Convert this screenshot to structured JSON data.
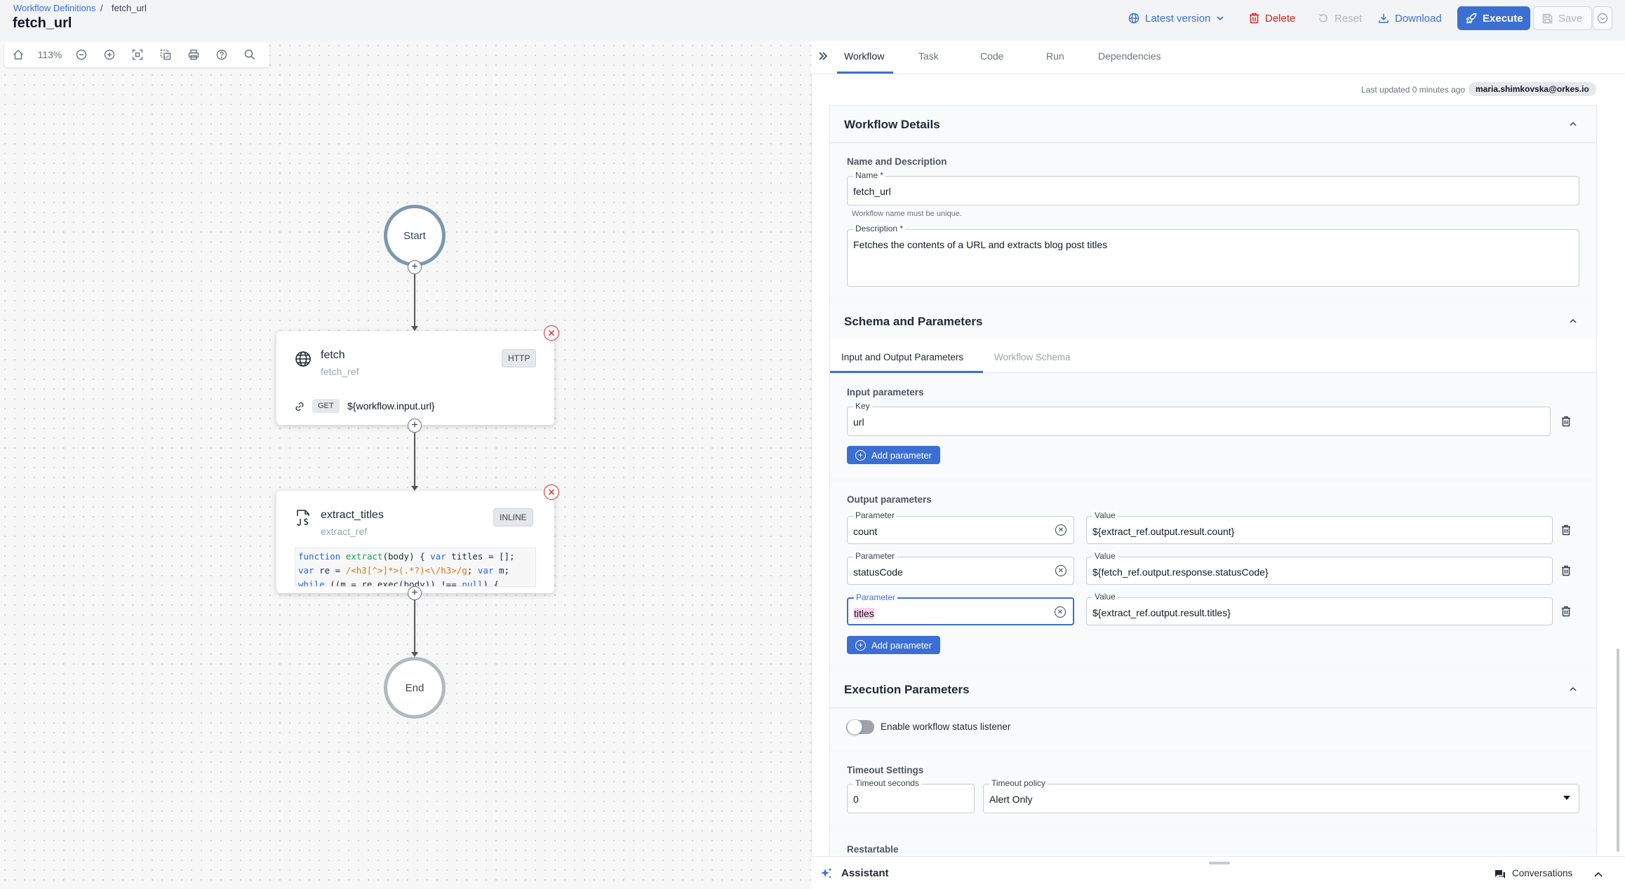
{
  "breadcrumb": {
    "parent": "Workflow Definitions",
    "separator": "/",
    "current": "fetch_url"
  },
  "page_title": "fetch_url",
  "header_actions": {
    "version": "Latest version",
    "delete": "Delete",
    "reset": "Reset",
    "download": "Download",
    "execute": "Execute",
    "save": "Save"
  },
  "canvas_toolbar": {
    "zoom": "113%"
  },
  "diagram": {
    "start": "Start",
    "end": "End",
    "fetch": {
      "name": "fetch",
      "ref": "fetch_ref",
      "type": "HTTP",
      "method": "GET",
      "uri": "${workflow.input.url}"
    },
    "extract": {
      "name": "extract_titles",
      "ref": "extract_ref",
      "type": "INLINE",
      "code_line1": {
        "kw1": "function",
        "fn": " extract",
        "rest1": "(body) { ",
        "kw2": "var",
        "rest2": " titles = [];"
      },
      "code_line2": {
        "kw1": "var",
        "rest1": " re = ",
        "regex": "/<h3[^>]*>(.*?)<\\/h3>/g",
        "rest2": "; ",
        "kw2": "var",
        "rest3": " m;"
      },
      "code_line3": {
        "kw1": "while",
        "rest1": " ((m = re.exec(body)) !== ",
        "kw2": "null",
        "rest2": ") {"
      }
    }
  },
  "panel_tabs": [
    "Workflow",
    "Task",
    "Code",
    "Run",
    "Dependencies"
  ],
  "meta": {
    "last_updated": "Last updated 0 minutes ago",
    "user": "maria.shimkovska@orkes.io"
  },
  "workflow_details": {
    "title": "Workflow Details",
    "subtitle": "Name and Description",
    "name_label": "Name *",
    "name_value": "fetch_url",
    "name_helper": "Workflow name must be unique.",
    "description_label": "Description *",
    "description_value": "Fetches the contents of a URL and extracts blog post titles"
  },
  "schema": {
    "title": "Schema and Parameters",
    "tabs": [
      "Input and Output Parameters",
      "Workflow Schema"
    ],
    "input_title": "Input parameters",
    "input_key_label": "Key",
    "input_key_value": "url",
    "add_parameter": "Add parameter",
    "output_title": "Output parameters",
    "param_label": "Parameter",
    "value_label": "Value",
    "outputs": [
      {
        "param": "count",
        "value": "${extract_ref.output.result.count}"
      },
      {
        "param": "statusCode",
        "value": "${fetch_ref.output.response.statusCode}"
      },
      {
        "param": "titles",
        "value": "${extract_ref.output.result.titles}"
      }
    ]
  },
  "execution": {
    "title": "Execution Parameters",
    "listener_label": "Enable workflow status listener",
    "listener_enabled": false,
    "timeout_title": "Timeout Settings",
    "timeout_seconds_label": "Timeout seconds",
    "timeout_seconds_value": "0",
    "timeout_policy_label": "Timeout policy",
    "timeout_policy_value": "Alert Only",
    "restartable_title": "Restartable"
  },
  "assistant": {
    "label": "Assistant",
    "conversations": "Conversations"
  },
  "colors": {
    "accent": "#3b6fd4",
    "danger": "#dc2626",
    "start_border": "#7d97ad"
  }
}
